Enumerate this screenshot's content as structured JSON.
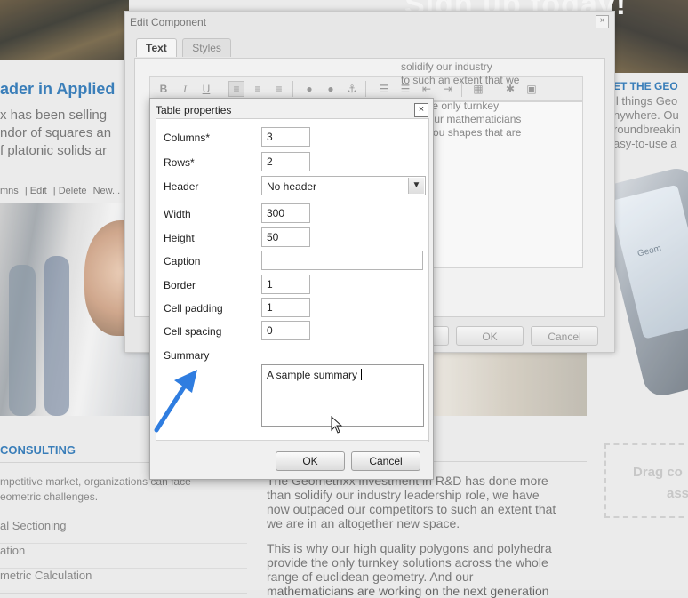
{
  "background": {
    "hero_title": "Sign up today!",
    "heading": "ader in Applied",
    "para_lines": [
      "x has been selling",
      "ndor of squares an",
      "f platonic solids ar"
    ],
    "edit_bar": [
      "mns",
      "Edit",
      "Delete",
      "New..."
    ],
    "consulting_heading": "CONSULTING",
    "consulting_lines": [
      "mpetitive market, organizations can face",
      "eometric challenges."
    ],
    "side_list": [
      "al Sectioning",
      "ation",
      "metric Calculation"
    ],
    "rd_para_1": [
      "The Geometrixx investment in R&D has done more",
      "than solidify our industry leadership role, we have",
      "now outpaced our competitors to such an extent that",
      "we are in an altogether new space."
    ],
    "rd_para_2": [
      "This is why our high quality polygons and polyhedra",
      "provide the only turnkey solutions across the whole",
      "range of euclidean geometry. And our",
      "mathematicians are working on the next generation"
    ],
    "get_geo_heading": "ET THE GEO",
    "geo_lines": [
      "ll things Geo",
      "nywhere. Ou",
      "roundbreakin",
      "asy-to-use a"
    ],
    "phone_logo": "Geom",
    "drag_lines": [
      "Drag co",
      "ass"
    ]
  },
  "edit_dialog": {
    "title": "Edit Component",
    "close_glyph": "×",
    "tabs": [
      "Text",
      "Styles"
    ],
    "toolbar": {
      "bold": "B",
      "italic": "I",
      "underline": "U"
    },
    "content_lines_1": [
      "solidify our industry",
      "to such an extent that we"
    ],
    "content_lines_2": [
      "vide the only turnkey",
      ". And our mathematicians",
      "bring you shapes that are"
    ],
    "ok_label": "OK",
    "cancel_label": "Cancel"
  },
  "table_dialog": {
    "title": "Table properties",
    "close_glyph": "×",
    "fields": {
      "columns": {
        "label": "Columns",
        "value": "3",
        "required": "*"
      },
      "rows": {
        "label": "Rows",
        "value": "2",
        "required": "*"
      },
      "header": {
        "label": "Header",
        "value": "No header"
      },
      "width": {
        "label": "Width",
        "value": "300"
      },
      "height": {
        "label": "Height",
        "value": "50"
      },
      "caption": {
        "label": "Caption",
        "value": ""
      },
      "border": {
        "label": "Border",
        "value": "1"
      },
      "cell_padding": {
        "label": "Cell padding",
        "value": "1"
      },
      "cell_spacing": {
        "label": "Cell spacing",
        "value": "0"
      },
      "summary": {
        "label": "Summary",
        "value": "A sample summary"
      }
    },
    "ok_label": "OK",
    "cancel_label": "Cancel"
  },
  "colors": {
    "link_blue": "#1f6db0",
    "annotation_arrow": "#2f7de0"
  }
}
